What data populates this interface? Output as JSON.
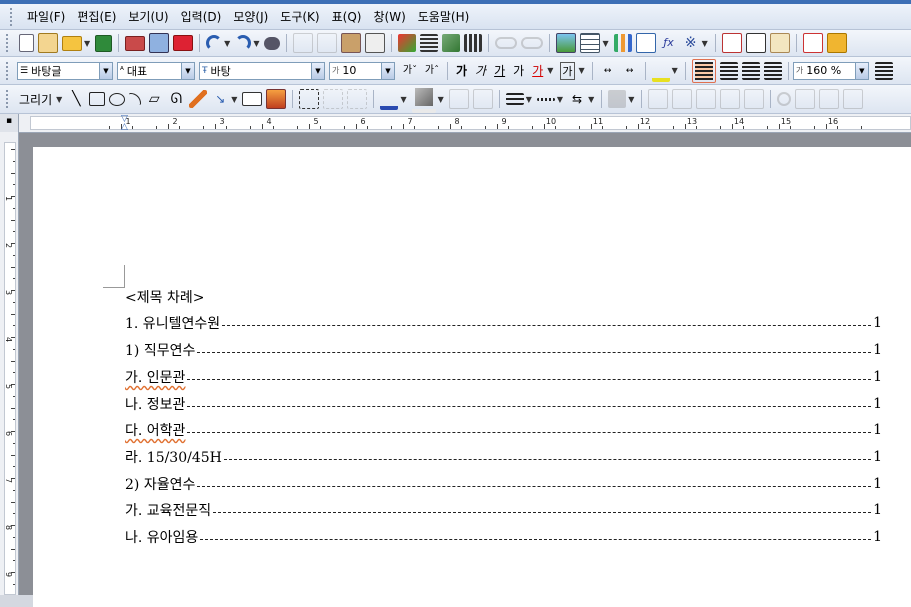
{
  "menu": [
    "파일(F)",
    "편집(E)",
    "보기(U)",
    "입력(D)",
    "모양(J)",
    "도구(K)",
    "표(Q)",
    "창(W)",
    "도움말(H)"
  ],
  "format_bar": {
    "style": "바탕글",
    "lang": "대표",
    "font": "바탕",
    "size": "10",
    "bold": "가",
    "italic": "가",
    "underline": "가",
    "strike": "가",
    "color": "가",
    "shade": "가",
    "zoom": "160 %"
  },
  "draw_bar": {
    "label": "그리기"
  },
  "ruler": {
    "numbers": [
      "1",
      "2",
      "3",
      "4",
      "5",
      "6",
      "7",
      "8",
      "9",
      "10",
      "11",
      "12",
      "13",
      "14",
      "15",
      "16"
    ]
  },
  "vruler": {
    "numbers": [
      "1",
      "2",
      "3",
      "4",
      "5",
      "6",
      "7",
      "8",
      "9"
    ]
  },
  "document": {
    "title": "<제목 차례>",
    "entries": [
      {
        "text": "1. 유니텔연수원",
        "page": "1"
      },
      {
        "text": "1) 직무연수",
        "page": "1"
      },
      {
        "text": "가. 인문관",
        "page": "1"
      },
      {
        "text": "나. 정보관",
        "page": "1"
      },
      {
        "text": "다. 어학관",
        "page": "1"
      },
      {
        "text": "라. 15/30/45H",
        "page": "1"
      },
      {
        "text": "2) 자율연수",
        "page": "1"
      },
      {
        "text": "가. 교육전문직",
        "page": "1"
      },
      {
        "text": "나. 유아임용",
        "page": "1"
      }
    ]
  },
  "colors": {
    "accent": "#3d6fb5",
    "toolbar_bg": "#dde5f1",
    "workspace": "#8c8f96"
  }
}
